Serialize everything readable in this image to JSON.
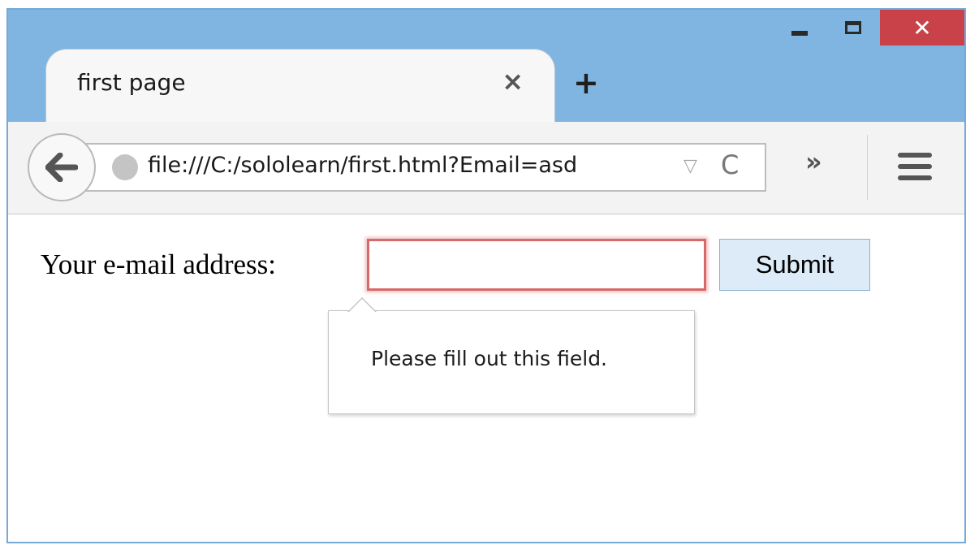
{
  "window": {
    "accent_color": "#7fb5e0",
    "close_color": "#c9424a",
    "controls": {
      "minimize_icon": "minimize-icon",
      "maximize_icon": "maximize-icon",
      "close_label": "✕"
    }
  },
  "tab": {
    "title": "first page",
    "close_label": "×",
    "new_tab_label": "+"
  },
  "navbar": {
    "back_icon": "back-arrow-icon",
    "url": "file:///C:/sololearn/first.html?Email=asd",
    "dropdown_label": "▽",
    "reload_label": "C",
    "overflow_label": "»",
    "menu_icon": "hamburger-menu-icon"
  },
  "form": {
    "label": "Your e-mail address:",
    "input_value": "",
    "submit_label": "Submit",
    "validation_message": "Please fill out this field.",
    "invalid_border_color": "#d66a6a"
  }
}
